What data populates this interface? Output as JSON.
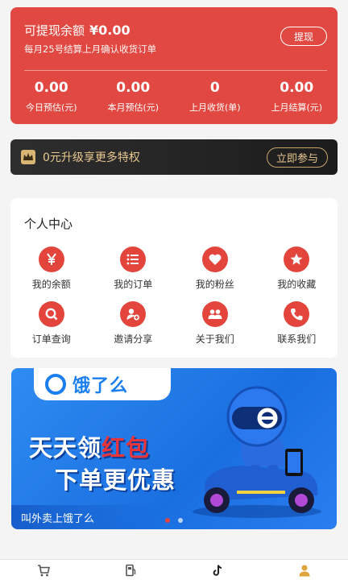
{
  "earnings": {
    "label": "可提现余额",
    "amount": "¥0.00",
    "note": "每月25号结算上月确认收货订单",
    "withdraw_label": "提现",
    "stats": [
      {
        "value": "0.00",
        "label": "今日预估(元)"
      },
      {
        "value": "0.00",
        "label": "本月预估(元)"
      },
      {
        "value": "0",
        "label": "上月收货(单)"
      },
      {
        "value": "0.00",
        "label": "上月结算(元)"
      }
    ]
  },
  "vip": {
    "text": "0元升级享更多特权",
    "button_label": "立即参与",
    "icon": "crown-icon"
  },
  "center": {
    "title": "个人中心",
    "items": [
      {
        "label": "我的余额",
        "icon": "yen-icon"
      },
      {
        "label": "我的订单",
        "icon": "list-icon"
      },
      {
        "label": "我的粉丝",
        "icon": "heart-icon"
      },
      {
        "label": "我的收藏",
        "icon": "star-icon"
      },
      {
        "label": "订单查询",
        "icon": "search-icon"
      },
      {
        "label": "邀请分享",
        "icon": "invite-icon"
      },
      {
        "label": "关于我们",
        "icon": "people-icon"
      },
      {
        "label": "联系我们",
        "icon": "phone-icon"
      }
    ]
  },
  "ad": {
    "brand": "饿了么",
    "line1_a": "天天领",
    "line1_b": "红包",
    "line2": "下单更优惠",
    "footer": "叫外卖上饿了么",
    "slide_count": 2,
    "active_slide": 1
  },
  "tabbar": {
    "tabs": [
      {
        "icon": "cart-icon",
        "active": false
      },
      {
        "icon": "gas-station-icon",
        "active": false
      },
      {
        "icon": "tiktok-icon",
        "active": false
      },
      {
        "icon": "user-icon",
        "active": true
      }
    ]
  },
  "colors": {
    "primary_red": "#e24842",
    "vip_gold": "#e9c88f",
    "tab_active": "#e0a23a"
  }
}
